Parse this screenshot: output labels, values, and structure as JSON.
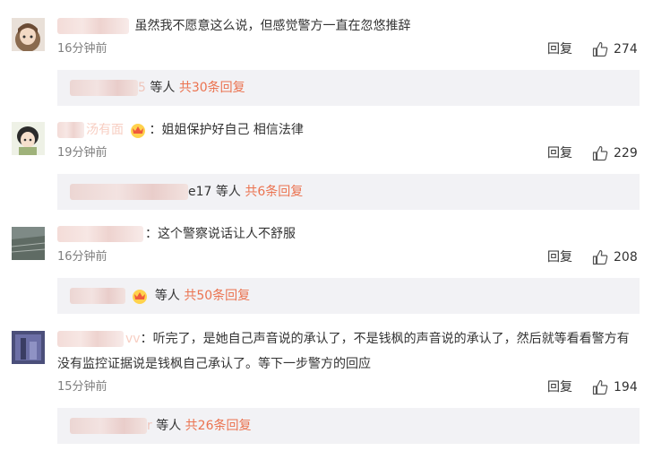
{
  "colors": {
    "accent": "#eb7350",
    "text": "#333333",
    "muted": "#808080",
    "reply_bg": "#f2f2f5"
  },
  "comments": [
    {
      "user_suffix": "",
      "text": "虽然我不愿意这么说，但感觉警方一直在忽悠推辞",
      "time": "16分钟前",
      "reply_label": "回复",
      "likes": "274",
      "replies_user_suffix": "5",
      "replies_others": "等人",
      "replies_link": "共30条回复"
    },
    {
      "user_suffix": "汤有面",
      "text": "：姐姐保护好自己 相信法律",
      "time": "19分钟前",
      "reply_label": "回复",
      "likes": "229",
      "replies_user_suffix": "e17",
      "replies_others": "等人",
      "replies_link": "共6条回复"
    },
    {
      "user_suffix": "",
      "text": "：这个警察说话让人不舒服",
      "time": "16分钟前",
      "reply_label": "回复",
      "likes": "208",
      "replies_user_suffix": "",
      "replies_others": "等人",
      "replies_link": "共50条回复"
    },
    {
      "user_suffix": "vv",
      "text": "：听完了，是她自己声音说的承认了，不是钱枫的声音说的承认了，然后就等看看警方有没有监控证据说是钱枫自己承认了。等下一步警方的回应",
      "time": "15分钟前",
      "reply_label": "回复",
      "likes": "194",
      "replies_user_suffix": "r",
      "replies_others": "等人",
      "replies_link": "共26条回复"
    }
  ]
}
